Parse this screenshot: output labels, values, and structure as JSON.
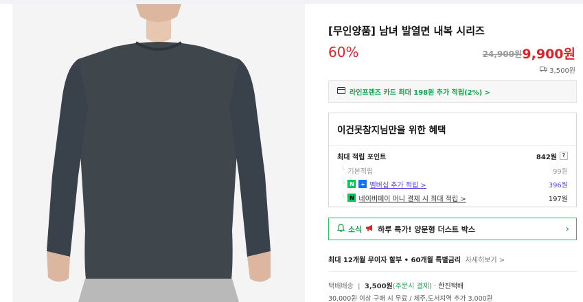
{
  "product": {
    "title": "[무인양품] 남녀 발열면 내복 시리즈",
    "discount": "60%",
    "original_price": "24,900원",
    "sale_price": "9,900원",
    "shipping_fee": "3,500원"
  },
  "card_promo": "라인프렌즈 카드 최대 198원 추가 적립(2%) >",
  "benefit": {
    "heading": "이건못참지님만을 위한 혜택",
    "rows": [
      {
        "label": "최대 적립 포인트",
        "value": "842원",
        "help": "?"
      },
      {
        "label": "기본적립",
        "value": "99원"
      },
      {
        "label": "멤버십 추가 적립 >",
        "value": "396원"
      },
      {
        "label": "네이버페이 머니 결제 시 최대 적립 >",
        "value": "197원"
      }
    ]
  },
  "news": {
    "label": "소식",
    "text": "하루 특가! 양문형 더스트 박스"
  },
  "installment": {
    "text": "최대 12개월 무이자 할부 • 60개월 특별금리",
    "detail": "자세히보기 >"
  },
  "delivery": {
    "type": "택배배송",
    "fee": "3,500원",
    "payment": "(주문시 결제)",
    "carrier": "· 한진택배",
    "free_condition": "30,000원 이상 구매 시 무료 / 제주,도서지역 추가 3,000원"
  },
  "colors": {
    "price_red": "#e0202a",
    "naver_green": "#03c75a",
    "membership_purple": "#5c3fe6"
  }
}
